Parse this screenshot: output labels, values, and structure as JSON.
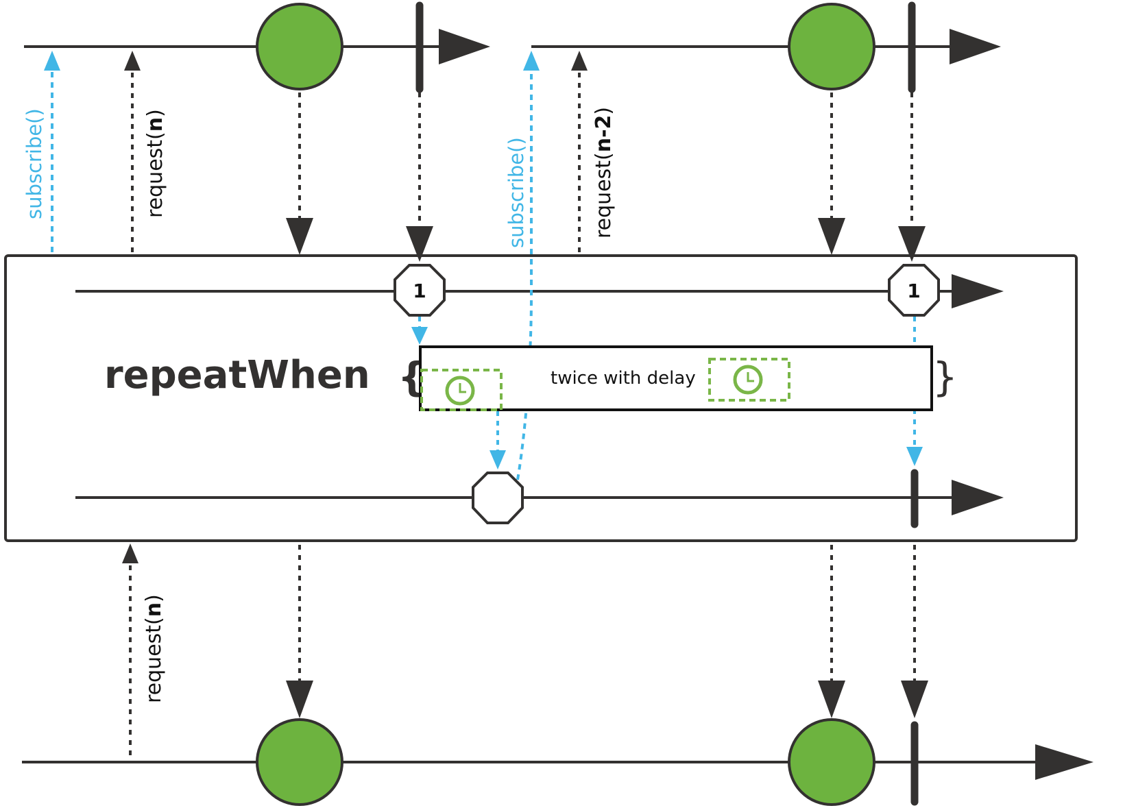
{
  "colors": {
    "line": "#333130",
    "accent_blue": "#41b6e6",
    "green_fill": "#6db33f",
    "green_stroke": "#333130",
    "clock_green": "#7ab648",
    "white": "#ffffff"
  },
  "top": {
    "subscribe_label_1": "subscribe()",
    "request_prefix_1": "request(",
    "request_arg_1": "n",
    "request_suffix_1": ")",
    "subscribe_label_2": "subscribe()",
    "request_prefix_2": "request(",
    "request_arg_2": "n-2",
    "request_suffix_2": ")"
  },
  "operator": {
    "name": "repeatWhen",
    "open_brace": "{",
    "close_brace": "}",
    "signal_value_1": "1",
    "signal_value_2": "1",
    "companion_text": "twice with delay",
    "icons": [
      "clock-icon",
      "clock-icon"
    ]
  },
  "bottom": {
    "request_prefix": "request(",
    "request_arg": "n",
    "request_suffix": ")"
  }
}
